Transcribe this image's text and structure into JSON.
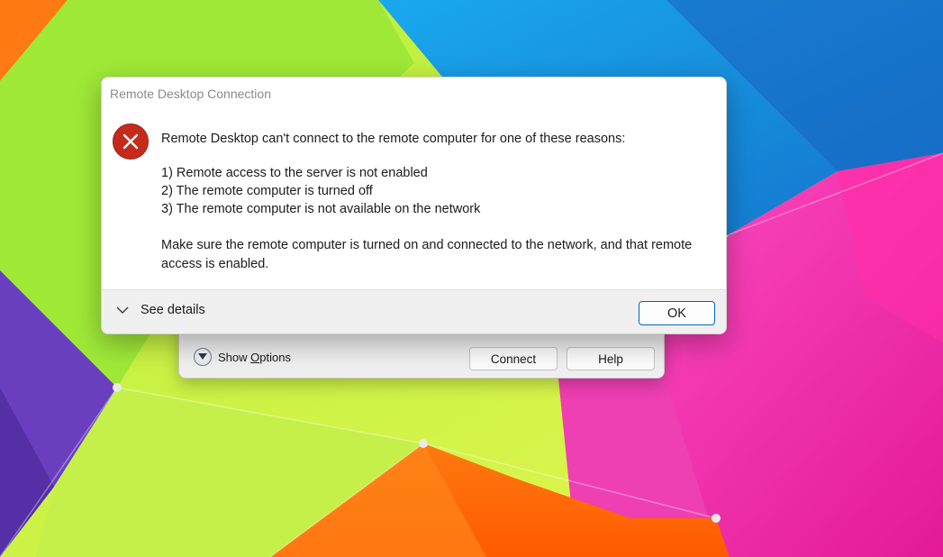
{
  "dialog": {
    "title": "Remote Desktop Connection",
    "icon": "error-icon",
    "message_intro": "Remote Desktop can't connect to the remote computer for one of these reasons:",
    "reasons": [
      "1) Remote access to the server is not enabled",
      "2) The remote computer is turned off",
      "3) The remote computer is not available on the network"
    ],
    "advice_line1": "Make sure the remote computer is turned on and connected to the network, and that remote",
    "advice_line2": "access is enabled.",
    "see_details_label": "See details",
    "ok_label": "OK",
    "accent_color": "#0067c0",
    "icon_color": "#c42b1c"
  },
  "rdc_window": {
    "show_options_prefix": "Show ",
    "show_options_underlined": "O",
    "show_options_suffix": "ptions",
    "connect_label": "Connect",
    "help_label": "Help"
  }
}
